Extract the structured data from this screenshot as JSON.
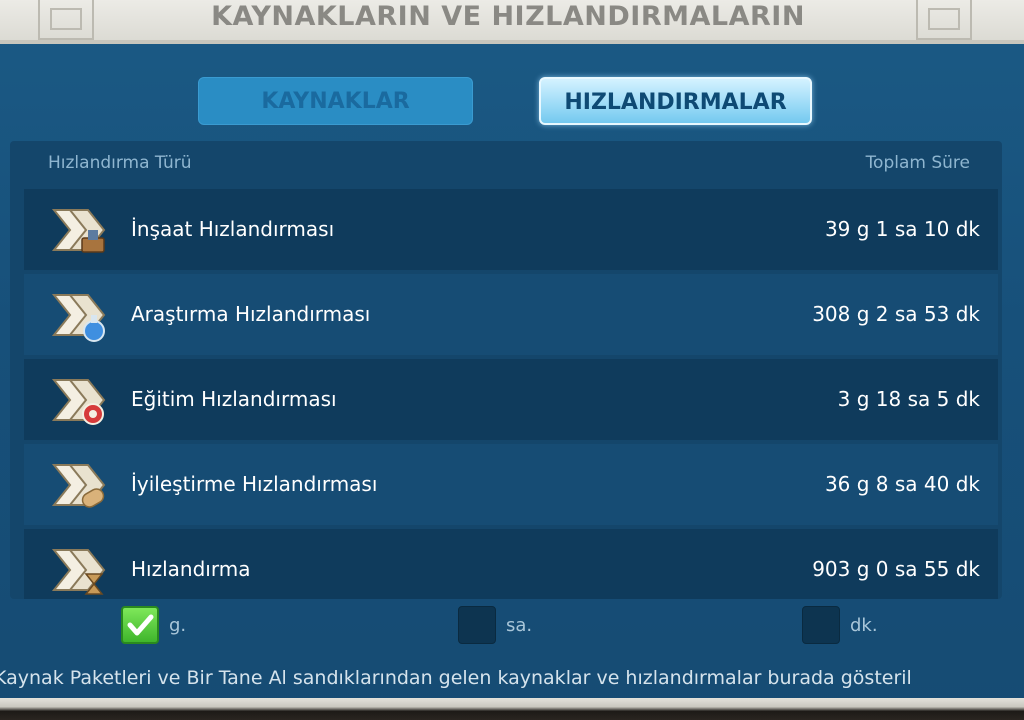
{
  "title": "KAYNAKLARIN VE HIZLANDIRMALARIN",
  "tabs": {
    "resources": "KAYNAKLAR",
    "speedups": "HIZLANDIRMALAR"
  },
  "columns": {
    "type": "Hızlandırma Türü",
    "total": "Toplam Süre"
  },
  "rows": [
    {
      "name": "İnşaat Hızlandırması",
      "time": "39 g 1 sa 10 dk",
      "icon": "construction-speedup-icon"
    },
    {
      "name": "Araştırma Hızlandırması",
      "time": "308 g 2 sa 53 dk",
      "icon": "research-speedup-icon"
    },
    {
      "name": "Eğitim Hızlandırması",
      "time": "3 g 18 sa 5 dk",
      "icon": "training-speedup-icon"
    },
    {
      "name": "İyileştirme Hızlandırması",
      "time": "36 g 8 sa 40 dk",
      "icon": "healing-speedup-icon"
    },
    {
      "name": "Hızlandırma",
      "time": "903 g 0 sa 55 dk",
      "icon": "universal-speedup-icon"
    }
  ],
  "filters": [
    {
      "label": "g.",
      "checked": true
    },
    {
      "label": "sa.",
      "checked": false
    },
    {
      "label": "dk.",
      "checked": false
    }
  ],
  "note": "Kaynak Paketleri ve Bir Tane Al sandıklarından gelen kaynaklar ve hızlandırmalar burada gösteril",
  "colors": {
    "accent": "#74c9ef",
    "panel": "#14466b",
    "check": "#3fb52c"
  }
}
